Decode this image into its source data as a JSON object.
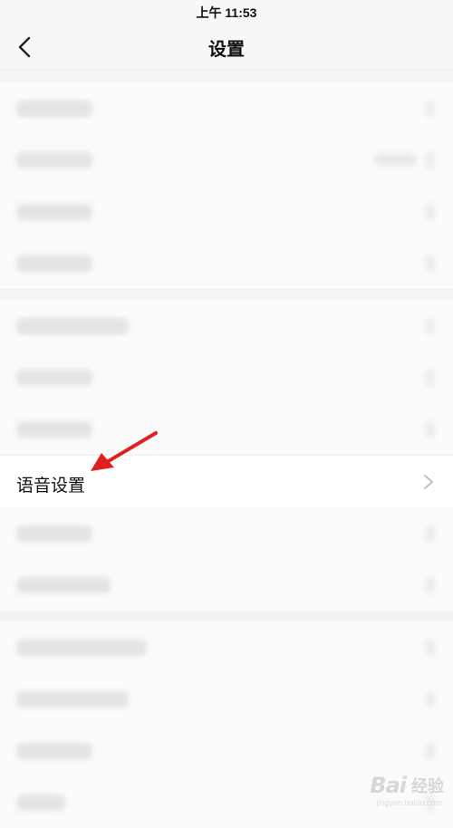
{
  "status_bar": {
    "time": "上午 11:53"
  },
  "nav": {
    "title": "设置"
  },
  "groups": [
    {
      "rows": [
        {
          "blurred": true,
          "w": 84,
          "value": false
        },
        {
          "blurred": true,
          "w": 84,
          "value": true
        },
        {
          "blurred": true,
          "w": 84,
          "value": false
        },
        {
          "blurred": true,
          "w": 84,
          "value": false
        }
      ]
    },
    {
      "rows": [
        {
          "blurred": true,
          "w": 124,
          "value": false
        },
        {
          "blurred": true,
          "w": 84,
          "value": false
        },
        {
          "blurred": true,
          "w": 84,
          "value": false
        },
        {
          "blurred": false,
          "label": "语音设置"
        },
        {
          "blurred": true,
          "w": 84,
          "value": false
        },
        {
          "blurred": true,
          "w": 104,
          "value": false
        }
      ]
    },
    {
      "rows": [
        {
          "blurred": true,
          "w": 144,
          "value": false
        },
        {
          "blurred": true,
          "w": 124,
          "value": false
        },
        {
          "blurred": true,
          "w": 84,
          "value": false
        },
        {
          "blurred": true,
          "w": 54,
          "value": false
        }
      ]
    }
  ],
  "watermark": {
    "logo": "Bai",
    "text": "经验",
    "url": "jingyan.baidu.com"
  },
  "colors": {
    "arrow": "#e02020",
    "chevron": "#b5b5b5"
  }
}
